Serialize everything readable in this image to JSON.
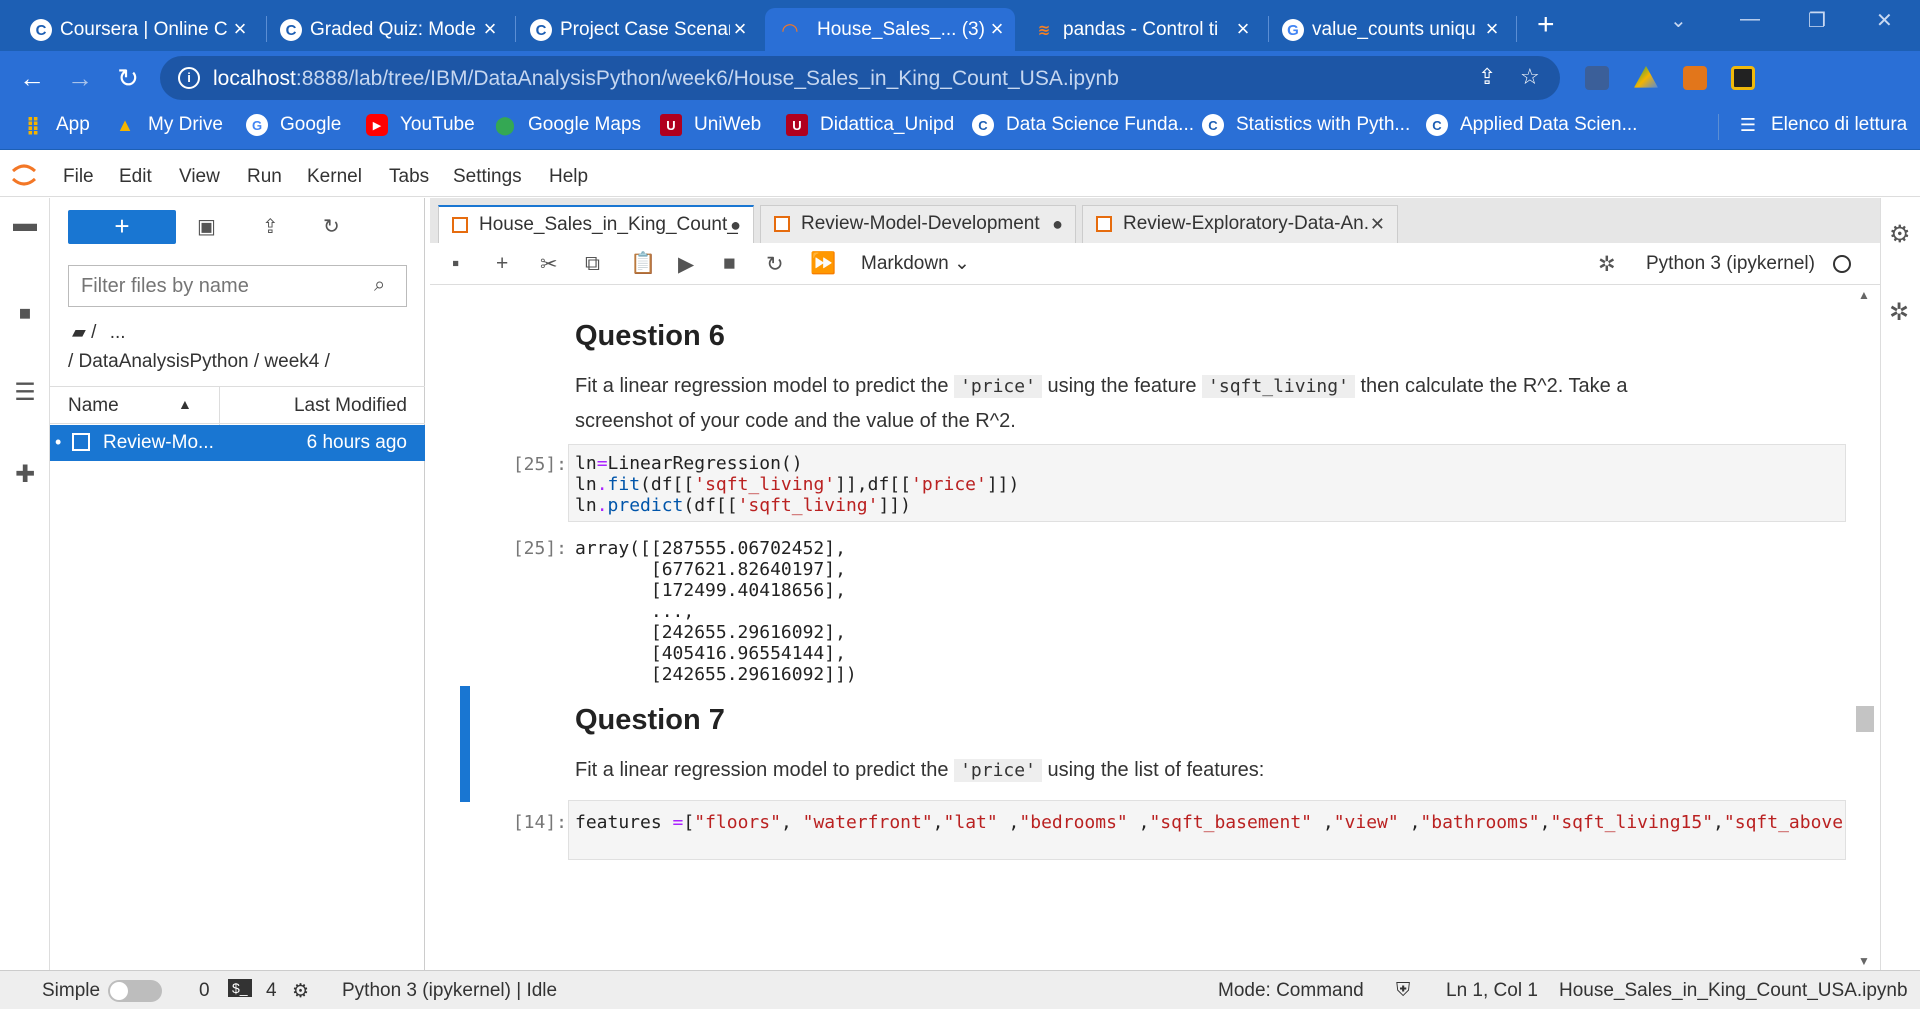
{
  "browser": {
    "tabs": [
      {
        "title": "Coursera | Online C",
        "icon": "C",
        "active": false
      },
      {
        "title": "Graded Quiz: Mode",
        "icon": "C",
        "active": false
      },
      {
        "title": "Project Case Scenar",
        "icon": "C",
        "active": false
      },
      {
        "title": "House_Sales_... (3)",
        "icon": "jupyter",
        "active": true
      },
      {
        "title": "pandas - Control ti",
        "icon": "stackoverflow",
        "active": false
      },
      {
        "title": "value_counts uniqu",
        "icon": "G",
        "active": false
      }
    ],
    "url_host": "localhost",
    "url_path": ":8888/lab/tree/IBM/DataAnalysisPython/week6/House_Sales_in_King_Count_USA.ipynb",
    "bookmarks": [
      {
        "label": "App",
        "icon": "apps-grid-icon"
      },
      {
        "label": "My Drive",
        "icon": "drive-icon"
      },
      {
        "label": "Google",
        "icon": "google-icon"
      },
      {
        "label": "YouTube",
        "icon": "youtube-icon"
      },
      {
        "label": "Google Maps",
        "icon": "maps-icon"
      },
      {
        "label": "UniWeb",
        "icon": "uniweb-icon"
      },
      {
        "label": "Didattica_Unipd",
        "icon": "unipd-icon"
      },
      {
        "label": "Data Science Funda...",
        "icon": "coursera-icon"
      },
      {
        "label": "Statistics with Pyth...",
        "icon": "coursera-icon"
      },
      {
        "label": "Applied Data Scien...",
        "icon": "coursera-icon"
      }
    ],
    "reading_list": "Elenco di lettura"
  },
  "menu": [
    "File",
    "Edit",
    "View",
    "Run",
    "Kernel",
    "Tabs",
    "Settings",
    "Help"
  ],
  "filebrowser": {
    "new_label": "+",
    "filter_placeholder": "Filter files by name",
    "crumb_root": "/",
    "crumb_more": "...",
    "crumb_path": "/ DataAnalysisPython / week4 /",
    "col_name": "Name",
    "col_modified": "Last Modified",
    "files": [
      {
        "name": "Review-Mo...",
        "modified": "6 hours ago"
      }
    ]
  },
  "doc_tabs": [
    {
      "title": "House_Sales_in_King_Count_",
      "mark": "●",
      "active": true
    },
    {
      "title": "Review-Model-Development",
      "mark": "●",
      "active": false
    },
    {
      "title": "Review-Exploratory-Data-An.",
      "mark": "✕",
      "active": false
    }
  ],
  "nb_toolbar": {
    "cell_type": "Markdown",
    "kernel": "Python 3 (ipykernel)"
  },
  "cells": {
    "q6_title": "Question 6",
    "q6_text_a": "Fit a linear regression model to predict the ",
    "q6_code_a": "'price'",
    "q6_text_b": " using the feature ",
    "q6_code_b": "'sqft_living'",
    "q6_text_c": " then calculate the R^2. Take a",
    "q6_text_d": "screenshot of your code and the value of the R^2.",
    "in25_prompt": "[25]:",
    "out25_prompt": "[25]:",
    "out25_lines": [
      "array([[287555.06702452],",
      "       [677621.82640197],",
      "       [172499.40418656],",
      "       ...,",
      "       [242655.29616092],",
      "       [405416.96554144],",
      "       [242655.29616092]])"
    ],
    "q7_title": "Question 7",
    "q7_text_a": "Fit a linear regression model to predict the ",
    "q7_code_a": "'price'",
    "q7_text_b": " using the list of features:",
    "in14_prompt": "[14]:"
  },
  "statusbar": {
    "mode_label": "Simple",
    "terminals": "0",
    "kernels": "4",
    "kernel_status": "Python 3 (ipykernel) | Idle",
    "mode": "Mode: Command",
    "cursor": "Ln 1, Col 1",
    "filename": "House_Sales_in_King_Count_USA.ipynb"
  }
}
